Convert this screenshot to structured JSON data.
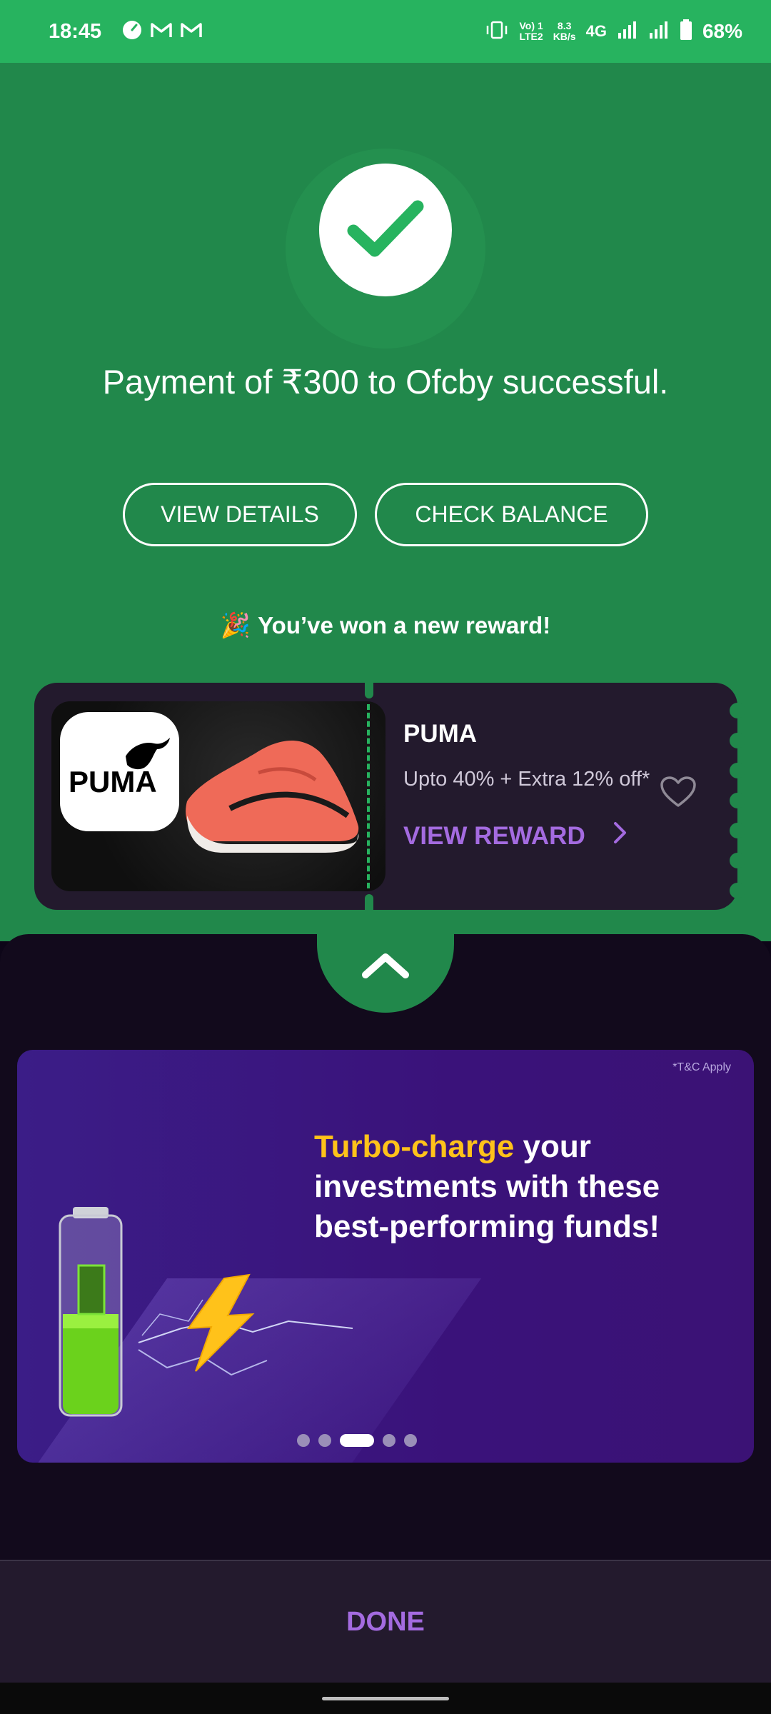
{
  "status_bar": {
    "time": "18:45",
    "volte_line1": "Vo) 1",
    "volte_line2": "LTE2",
    "speed_value": "8.3",
    "speed_unit": "KB/s",
    "network": "4G",
    "battery": "68%",
    "icons": [
      "speedometer-icon",
      "gmail-icon",
      "gmail-icon",
      "vibrate-icon",
      "signal-icon",
      "signal-icon",
      "battery-icon"
    ]
  },
  "payment": {
    "message": "Payment of ₹300 to Ofcby successful.",
    "view_details_label": "VIEW DETAILS",
    "check_balance_label": "CHECK BALANCE"
  },
  "reward": {
    "heading": "You’ve won a new reward!",
    "heading_emoji": "🎉",
    "brand": "PUMA",
    "logo_text": "PUMA",
    "offer": "Upto 40% + Extra 12% off*",
    "cta": "VIEW REWARD"
  },
  "banner": {
    "tnc": "*T&C Apply",
    "headline_highlight": "Turbo-charge",
    "headline_rest": " your investments with these best-performing funds!",
    "carousel": {
      "count": 5,
      "active_index": 2
    }
  },
  "footer": {
    "done_label": "DONE"
  },
  "colors": {
    "status_green": "#27b35f",
    "bg_green": "#21884b",
    "ticket_bg": "#231a2d",
    "accent_purple": "#a46be0",
    "banner_purple": "#3b1d87",
    "highlight_yellow": "#ffc21a"
  }
}
